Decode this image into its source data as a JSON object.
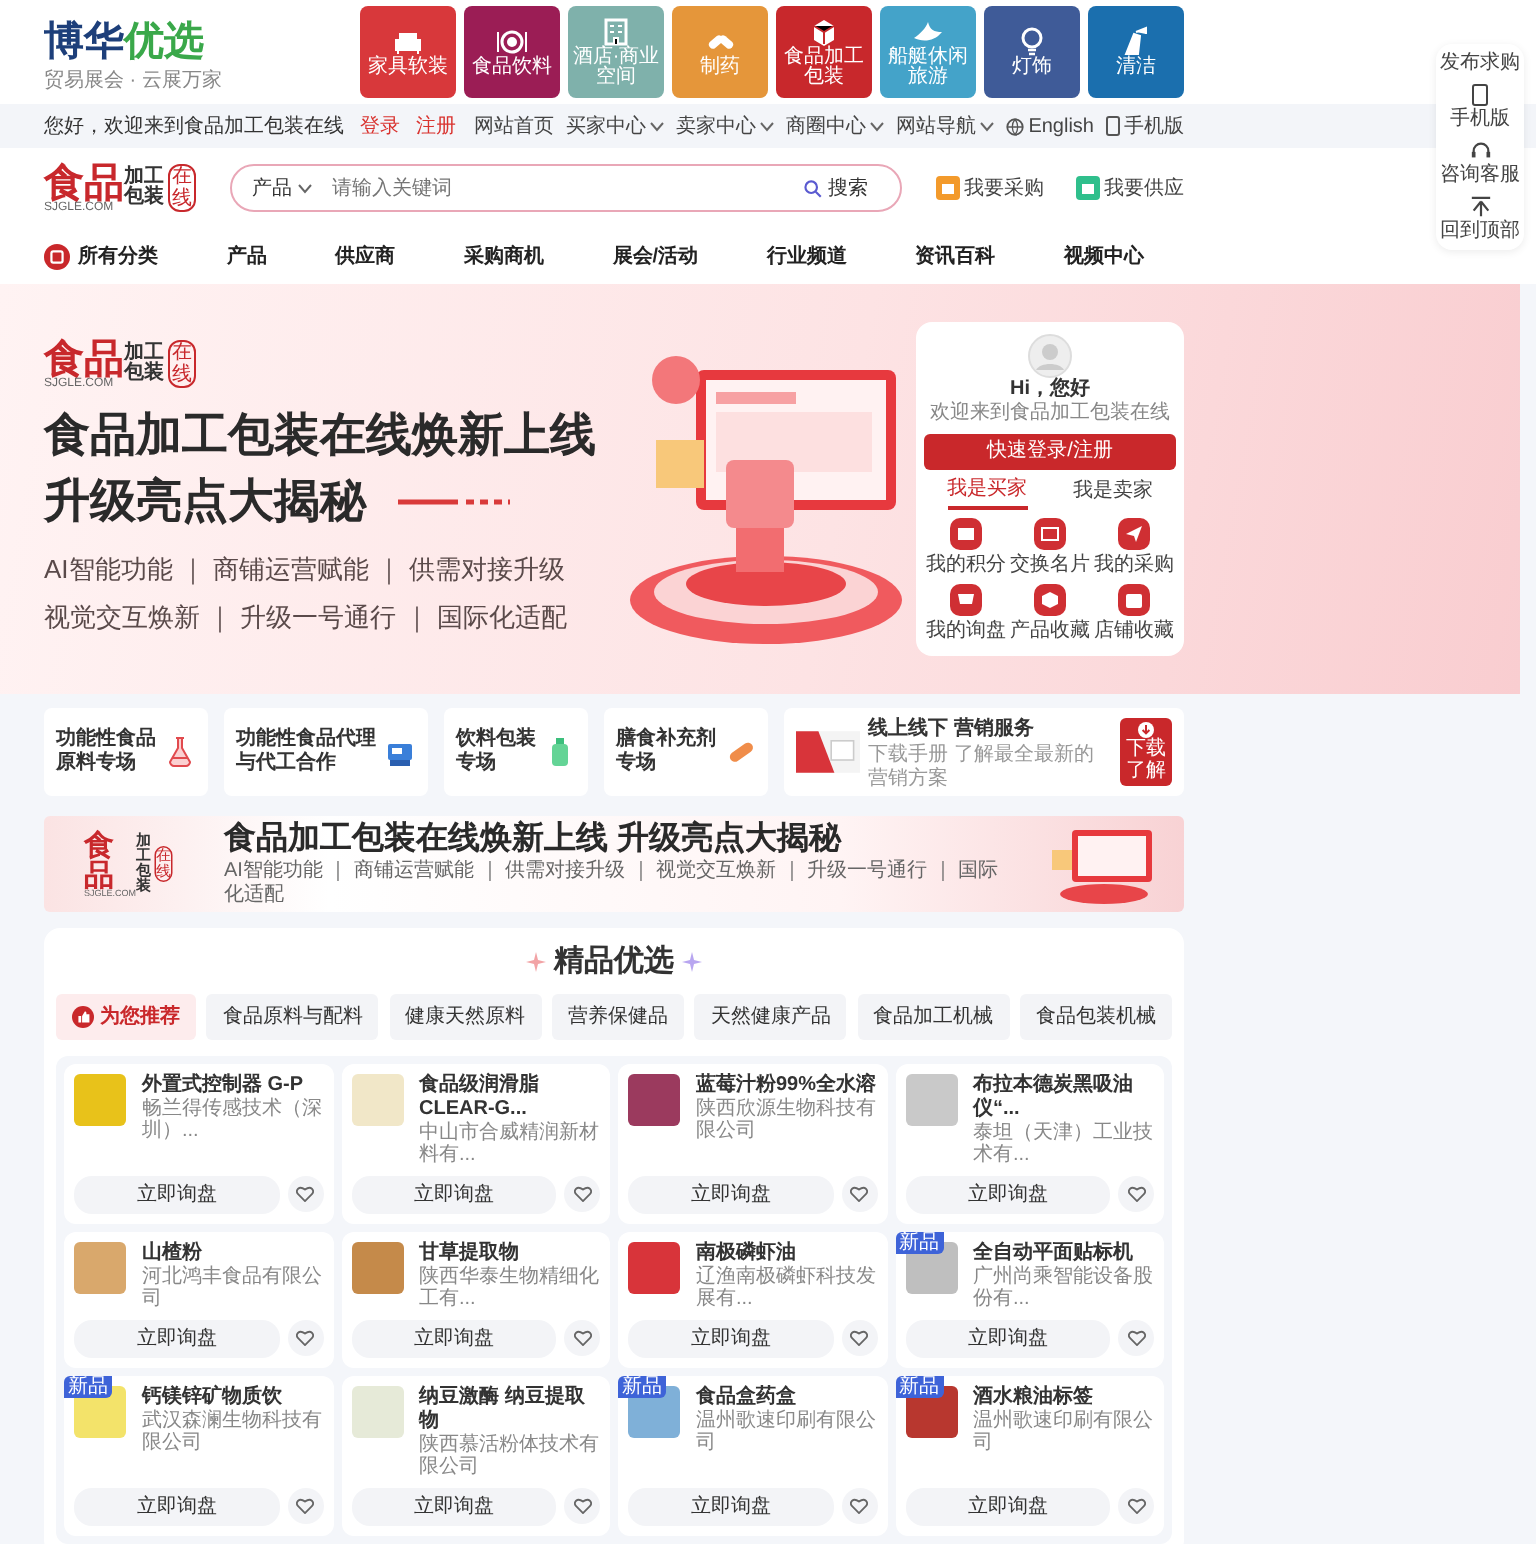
{
  "top_bar": {
    "brand": {
      "first": "博华",
      "second": "优选",
      "slogan": "贸易展会 · 云展万家"
    },
    "categories": [
      {
        "label": "家具软装",
        "color": "#d8383b"
      },
      {
        "label": "食品饮料",
        "color": "#9b1d55"
      },
      {
        "label": "酒店·商业空间",
        "color": "#7fb1ab"
      },
      {
        "label": "制药",
        "color": "#e5963a"
      },
      {
        "label": "食品加工包装",
        "color": "#c8282c"
      },
      {
        "label": "船艇休闲旅游",
        "color": "#44a3c9"
      },
      {
        "label": "灯饰",
        "color": "#3f5b98"
      },
      {
        "label": "清洁",
        "color": "#1b6fae"
      }
    ]
  },
  "info_bar": {
    "greeting": "您好，欢迎来到食品加工包装在线",
    "login": "登录",
    "register": "注册",
    "links": [
      {
        "label": "网站首页",
        "kind": "link"
      },
      {
        "label": "买家中心",
        "kind": "menu"
      },
      {
        "label": "卖家中心",
        "kind": "menu"
      },
      {
        "label": "商圈中心",
        "kind": "menu"
      },
      {
        "label": "网站导航",
        "kind": "menu"
      },
      {
        "label": "English",
        "kind": "language"
      },
      {
        "label": "手机版",
        "kind": "mobile"
      }
    ]
  },
  "header": {
    "logo": {
      "main": "食品",
      "top": "加工",
      "bottom": "包装",
      "badge": "在线",
      "domain": "SJGLE.COM"
    },
    "search": {
      "scope": "产品",
      "placeholder": "请输入关键词",
      "button": "搜索"
    },
    "actions": [
      {
        "label": "我要采购",
        "color": "#f39a2b"
      },
      {
        "label": "我要供应",
        "color": "#2fbf8c"
      }
    ]
  },
  "nav": [
    {
      "label": "所有分类",
      "kind": "all"
    },
    {
      "label": "产品",
      "kind": "link"
    },
    {
      "label": "供应商",
      "kind": "link"
    },
    {
      "label": "采购商机",
      "kind": "link"
    },
    {
      "label": "展会/活动",
      "kind": "link"
    },
    {
      "label": "行业频道",
      "kind": "link"
    },
    {
      "label": "资讯百科",
      "kind": "link"
    },
    {
      "label": "视频中心",
      "kind": "link"
    }
  ],
  "hero": {
    "logo": {
      "main": "食品",
      "top": "加工",
      "bottom": "包装",
      "badge": "在线",
      "domain": "SJGLE.COM"
    },
    "title_lines": [
      "食品加工包装在线焕新上线",
      "升级亮点大揭秘"
    ],
    "feature_lines": [
      "AI智能功能 ｜ 商铺运营赋能 ｜ 供需对接升级",
      "视觉交互焕新 ｜ 升级一号通行 ｜ 国际化适配"
    ],
    "user_card": {
      "greeting": "Hi，您好",
      "welcome": "欢迎来到食品加工包装在线",
      "login_button": "快速登录/注册",
      "tabs": [
        {
          "label": "我是买家",
          "selected": true
        },
        {
          "label": "我是卖家",
          "selected": false
        }
      ],
      "shortcuts": [
        "我的积分",
        "交换名片",
        "我的采购",
        "我的询盘",
        "产品收藏",
        "店铺收藏"
      ]
    }
  },
  "zones": [
    {
      "label": "功能性食品原料专场"
    },
    {
      "label": "功能性食品代理与代工合作"
    },
    {
      "label": "饮料包装专场"
    },
    {
      "label": "膳食补充剂专场"
    }
  ],
  "promo": {
    "title": "线上线下 营销服务",
    "subtitle": "下载手册 了解最全最新的营销方案",
    "button": "下载了解"
  },
  "banner": {
    "logo": {
      "main": "食品",
      "top": "加工",
      "bottom": "包装",
      "badge": "在线",
      "domain": "SJGLE.COM"
    },
    "title": "食品加工包装在线焕新上线 升级亮点大揭秘",
    "subtitle": "AI智能功能 ｜ 商铺运营赋能 ｜ 供需对接升级 ｜ 视觉交互焕新 ｜ 升级一号通行 ｜ 国际化适配"
  },
  "picks": {
    "title": "精品优选",
    "tabs": [
      {
        "label": "为您推荐",
        "selected": true
      },
      {
        "label": "食品原料与配料",
        "selected": false
      },
      {
        "label": "健康天然原料",
        "selected": false
      },
      {
        "label": "营养保健品",
        "selected": false
      },
      {
        "label": "天然健康产品",
        "selected": false
      },
      {
        "label": "食品加工机械",
        "selected": false
      },
      {
        "label": "食品包装机械",
        "selected": false
      }
    ],
    "products": [
      {
        "name": "外置式控制器 G-P",
        "company": "畅兰得传感技术（深圳）...",
        "button": "立即询盘"
      },
      {
        "name": "食品级润滑脂CLEAR-G...",
        "company": "中山市合威精润新材料有...",
        "button": "立即询盘"
      },
      {
        "name": "蓝莓汁粉99%全水溶",
        "company": "陕西欣源生物科技有限公司",
        "button": "立即询盘"
      },
      {
        "name": "布拉本德炭黑吸油仪“...",
        "company": "泰坦（天津）工业技术有...",
        "button": "立即询盘"
      },
      {
        "name": "山楂粉",
        "company": "河北鸿丰食品有限公司",
        "button": "立即询盘"
      },
      {
        "name": "甘草提取物",
        "company": "陕西华泰生物精细化工有...",
        "button": "立即询盘"
      },
      {
        "name": "南极磷虾油",
        "company": "辽渔南极磷虾科技发展有...",
        "button": "立即询盘"
      },
      {
        "name": "全自动平面贴标机",
        "company": "广州尚乘智能设备股份有...",
        "button": "立即询盘",
        "badge": "新品"
      },
      {
        "name": "钙镁锌矿物质饮",
        "company": "武汉森澜生物科技有限公司",
        "button": "立即询盘",
        "badge": "新品"
      },
      {
        "name": "纳豆激酶 纳豆提取物",
        "company": "陕西慕活粉体技术有限公司",
        "button": "立即询盘"
      },
      {
        "name": "食品盒药盒",
        "company": "温州歌速印刷有限公司",
        "button": "立即询盘",
        "badge": "新品"
      },
      {
        "name": "酒水粮油标签",
        "company": "温州歌速印刷有限公司",
        "button": "立即询盘",
        "badge": "新品"
      }
    ]
  },
  "side_toolbar": [
    {
      "label": "发布求购",
      "kind": "post"
    },
    {
      "label": "手机版",
      "kind": "mobile"
    },
    {
      "label": "咨询客服",
      "kind": "service"
    },
    {
      "label": "回到顶部",
      "kind": "top"
    }
  ]
}
